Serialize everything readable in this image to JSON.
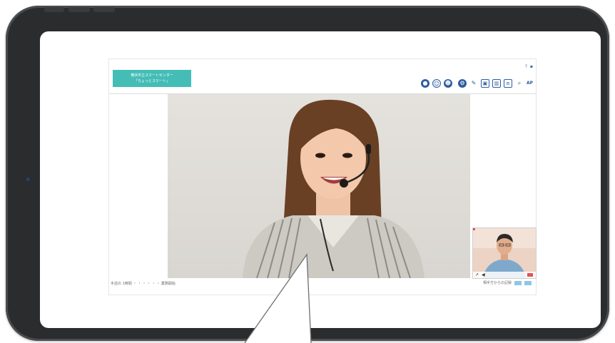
{
  "app": {
    "brand_line1": "横浜市立スマートセンター",
    "brand_line2": "「ちょっとスマート」",
    "header_links": [
      "?",
      "▪"
    ],
    "toolbar_icons": [
      "avatar-icon",
      "smile-icon",
      "face-icon",
      "settings-icon",
      "pen-icon",
      "image-icon",
      "chart-icon",
      "text-icon",
      "zoom-icon",
      "ap-icon"
    ],
    "toolbar_last_label": "AP",
    "footer_status": "手話の 1時間 ・ ・ ・ ・ ・ ・ 業務開始",
    "footer_right_label": "相手方からの記録"
  },
  "colors": {
    "brand": "#43bdb6",
    "toolbar": "#2e5d9e",
    "tablet_frame": "#2b2c2e"
  }
}
